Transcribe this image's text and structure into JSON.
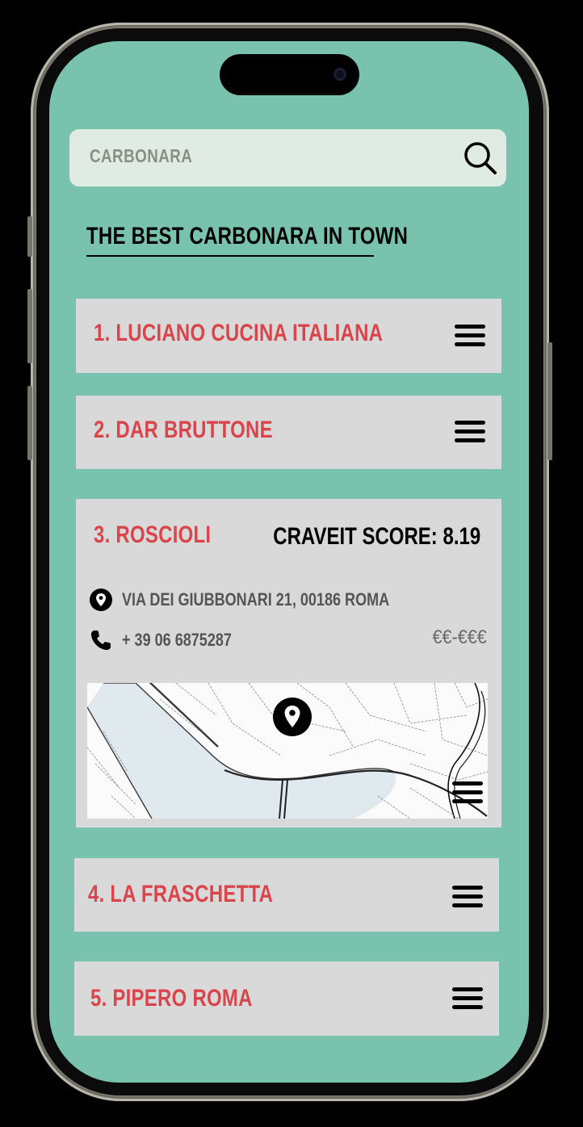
{
  "search": {
    "value": "CARBONARA"
  },
  "section_title": "THE BEST CARBONARA IN TOWN",
  "restaurants": [
    {
      "label": "1. LUCIANO CUCINA ITALIANA"
    },
    {
      "label": "2. DAR BRUTTONE"
    },
    {
      "label": "3. ROSCIOLI",
      "score": "CRAVEIT SCORE: 8.19",
      "address": "VIA DEI GIUBBONARI 21, 00186 ROMA",
      "phone": "+ 39 06 6875287",
      "price": "€€-€€€",
      "expanded": true
    },
    {
      "label": "4. LA FRASCHETTA"
    },
    {
      "label": "5. PIPERO ROMA"
    }
  ],
  "colors": {
    "screen_bg": "#79c3ae",
    "card_bg": "#d9d9d9",
    "title_accent": "#d9454a",
    "search_bg": "#e0ece3"
  },
  "icons": [
    "search-icon",
    "menu-icon",
    "location-pin-icon",
    "phone-icon",
    "map-marker-icon"
  ]
}
